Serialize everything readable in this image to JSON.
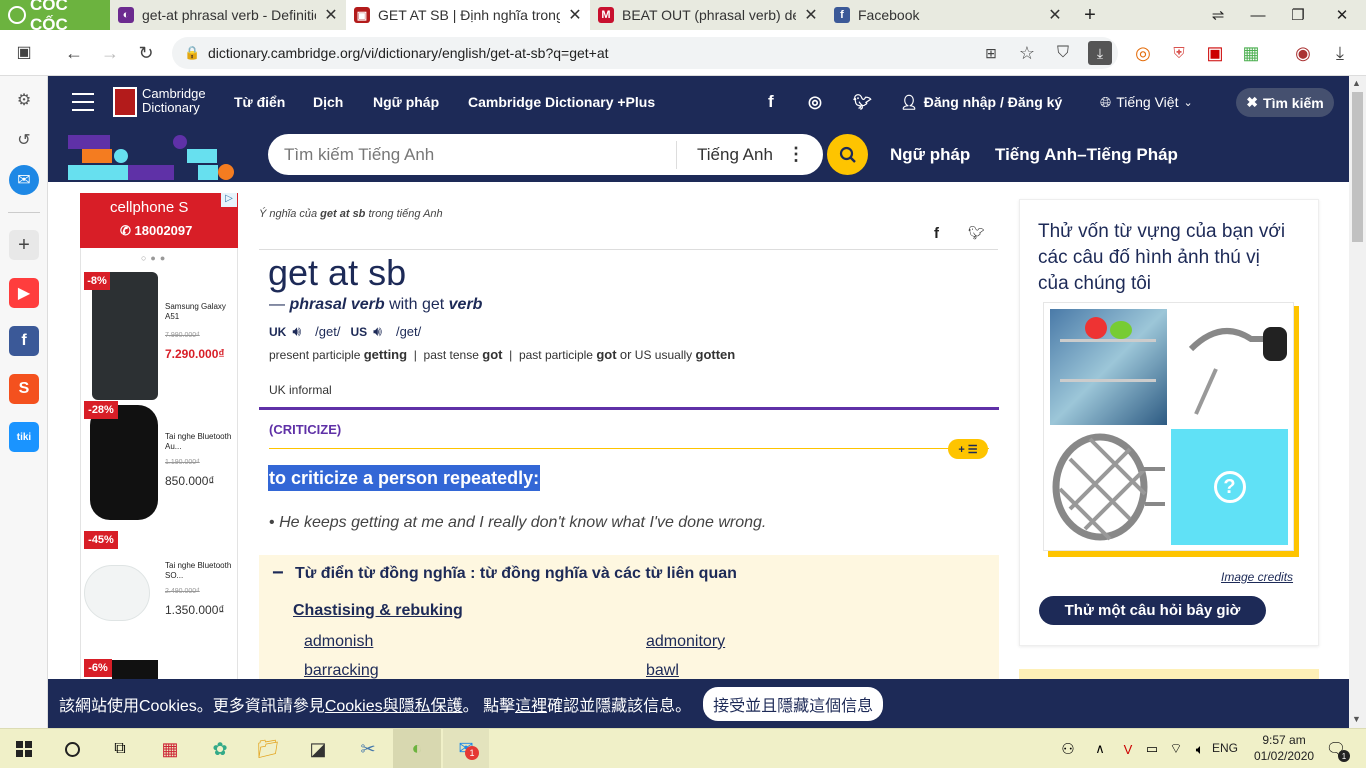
{
  "browser": {
    "brand": "CỐC CỐC",
    "tabs": [
      {
        "title": "get-at phrasal verb - Definitio",
        "active": false
      },
      {
        "title": "GET AT SB | Định nghĩa trong",
        "active": true
      },
      {
        "title": "BEAT OUT (phrasal verb) defin",
        "active": false
      },
      {
        "title": "Facebook",
        "active": false
      }
    ],
    "url": "dictionary.cambridge.org/vi/dictionary/english/get-at-sb?q=get+at"
  },
  "header": {
    "logo_line1": "Cambridge",
    "logo_line2": "Dictionary",
    "nav": [
      "Từ điển",
      "Dịch",
      "Ngữ pháp",
      "Cambridge Dictionary +Plus"
    ],
    "login": "Đăng nhập / Đăng ký",
    "language": "Tiếng Việt",
    "search_button": "Tìm kiếm"
  },
  "searchbar": {
    "placeholder": "Tìm kiếm Tiếng Anh",
    "dictionary": "Tiếng Anh",
    "link1": "Ngữ pháp",
    "link2": "Tiếng Anh–Tiếng Pháp"
  },
  "ad": {
    "brand": "cellphone S",
    "phone": "18002097",
    "products": [
      {
        "discount": "-8%",
        "name": "Samsung Galaxy A51",
        "old": "7.990.000₫",
        "price": "7.290.000₫"
      },
      {
        "discount": "-28%",
        "name": "Tai nghe Bluetooth Au...",
        "old": "1.190.000₫",
        "price": "850.000₫"
      },
      {
        "discount": "-45%",
        "name": "Tai nghe Bluetooth SO...",
        "old": "2.490.000₫",
        "price": "1.350.000₫"
      },
      {
        "discount": "-6%"
      }
    ]
  },
  "entry": {
    "breadcrumb_pre": "Ý nghĩa của",
    "breadcrumb_word": "get at sb",
    "breadcrumb_post": "trong tiếng Anh",
    "headword": "get at sb",
    "pos_dash": "—",
    "pos": "phrasal verb",
    "pos_with": "with get",
    "pos_verb": "verb",
    "uk": "UK",
    "uk_ipa": "/ɡet/",
    "us": "US",
    "us_ipa": "/ɡet/",
    "inflections": {
      "pp_label": "present participle",
      "pp": "getting",
      "pt_label": "past tense",
      "pt": "got",
      "pastp_label": "past participle",
      "pastp": "got",
      "or": "or",
      "us_label": "US usually",
      "us_form": "gotten",
      "sep": "|"
    },
    "labels": "UK informal",
    "guideword": "(CRITICIZE)",
    "definition": "to criticize a person repeatedly:",
    "example": "He keeps getting at me and I really don't know what I've done wrong.",
    "bullet": "•",
    "thesaurus_toggle": "−",
    "thesaurus_title": "Từ điển từ đồng nghĩa : từ đồng nghĩa và các từ liên quan",
    "thesaurus_heading": "Chastising & rebuking",
    "thesaurus_words": [
      "admonish",
      "admonitory",
      "barracking",
      "bawl"
    ],
    "add_list": "+ ☰"
  },
  "quiz": {
    "text": "Thử vốn từ vựng của bạn với các câu đố hình ảnh thú vị của chúng tôi",
    "credits": "Image credits",
    "button": "Thử một câu hỏi bây giờ"
  },
  "cookie": {
    "pre": "該網站使用Cookies。更多資訊請參見",
    "link1": "Cookies與隱私保護",
    "mid": "。 點擊",
    "link2": "這裡",
    "post": "確認並隱藏該信息。",
    "button": "接受並且隱藏這個信息"
  },
  "taskbar": {
    "lang": "ENG",
    "time": "9:57 am",
    "date": "01/02/2020",
    "notifications": "1",
    "zalo_badge": "1"
  },
  "colors": {
    "navy": "#1d2a57",
    "yellow": "#fec400",
    "purple": "#5f31a7",
    "highlight": "#3367d6",
    "coccoc_green": "#6cb33f"
  }
}
